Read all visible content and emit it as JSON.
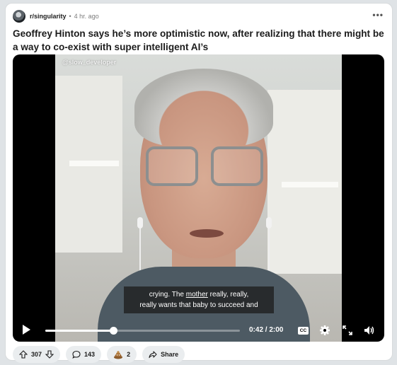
{
  "post": {
    "subreddit": "r/singularity",
    "separator": "•",
    "time": "4 hr. ago",
    "more": "•••",
    "title": "Geoffrey Hinton says he’s more optimistic now, after realizing that there might be a way to co-exist with super intelligent AI’s"
  },
  "video": {
    "watermark": "@slow_developer",
    "caption_line1_pre": "crying. The ",
    "caption_line1_underlined": "mother",
    "caption_line1_post": " really, really,",
    "caption_line2": "really wants that baby to succeed and",
    "time_readout": "0:42 / 2:00",
    "progress": 0.35,
    "cc_label": "CC"
  },
  "actions": {
    "votes": "307",
    "comments": "143",
    "awards": "2",
    "share": "Share"
  },
  "colors": {
    "card_bg": "#ffffff",
    "pill_bg": "#eaedef",
    "video_bg": "#000000"
  }
}
